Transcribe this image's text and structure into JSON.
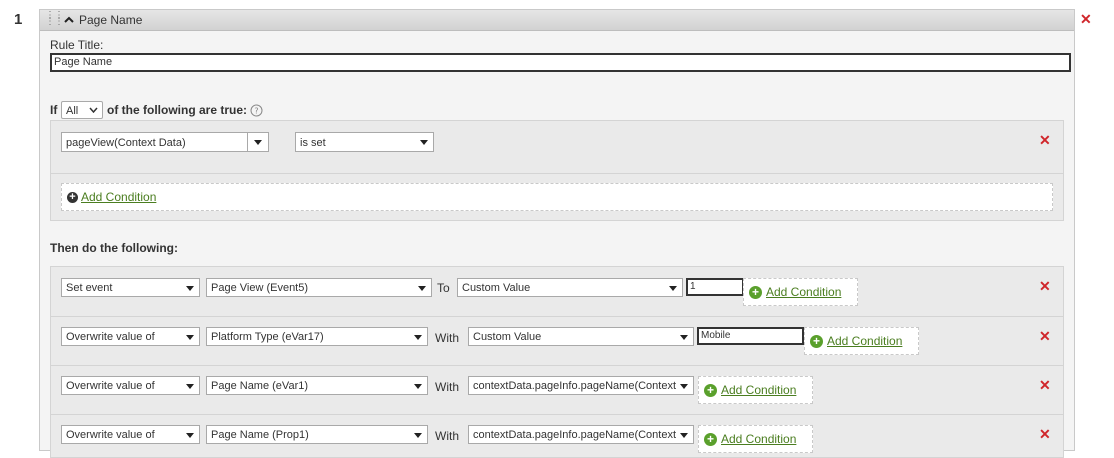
{
  "rule": {
    "number": "1",
    "header_title": "Page Name",
    "title_label": "Rule Title:",
    "title_value": "Page Name"
  },
  "conditions": {
    "if_label": "If",
    "match_select": "All",
    "suffix": "of the following are true:",
    "help_icon": "question-circle-icon",
    "items": [
      {
        "variable": "pageView(Context Data)",
        "operator": "is set"
      }
    ],
    "add_condition_label": "Add Condition"
  },
  "actions": {
    "heading": "Then do the following:",
    "rows": [
      {
        "action": "Set event",
        "target": "Page View (Event5)",
        "connector": "To",
        "source": "Custom Value",
        "value": "1",
        "add_condition_label": "Add Condition"
      },
      {
        "action": "Overwrite value of",
        "target": "Platform Type (eVar17)",
        "connector": "With",
        "source": "Custom Value",
        "value": "Mobile",
        "add_condition_label": "Add Condition"
      },
      {
        "action": "Overwrite value of",
        "target": "Page Name (eVar1)",
        "connector": "With",
        "source": "contextData.pageInfo.pageName(Context",
        "add_condition_label": "Add Condition"
      },
      {
        "action": "Overwrite value of",
        "target": "Page Name (Prop1)",
        "connector": "With",
        "source": "contextData.pageInfo.pageName(Context",
        "add_condition_label": "Add Condition"
      }
    ]
  },
  "colors": {
    "delete": "#d0262b",
    "link": "#4a7d1f",
    "plus": "#5aa02c"
  }
}
